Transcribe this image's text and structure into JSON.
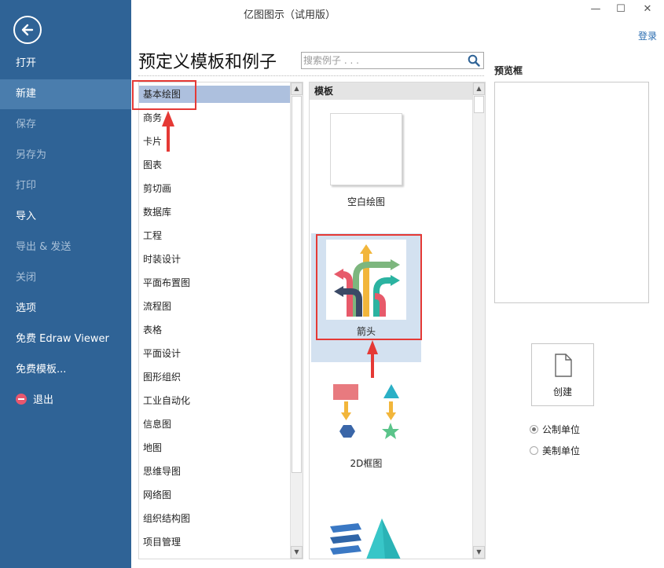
{
  "window": {
    "title": "亿图图示（试用版）",
    "minimize": "—",
    "maximize": "☐",
    "close": "✕",
    "login": "登录"
  },
  "sidebar": {
    "items": [
      {
        "label": "打开"
      },
      {
        "label": "新建"
      },
      {
        "label": "保存"
      },
      {
        "label": "另存为"
      },
      {
        "label": "打印"
      },
      {
        "label": "导入"
      },
      {
        "label": "导出 & 发送"
      },
      {
        "label": "关闭"
      },
      {
        "label": "选项"
      },
      {
        "label": "免费 Edraw Viewer"
      },
      {
        "label": "免费模板..."
      },
      {
        "label": "退出"
      }
    ]
  },
  "main": {
    "heading": "预定义模板和例子",
    "search_placeholder": "搜索例子 . . .",
    "categories": [
      "基本绘图",
      "商务",
      "卡片",
      "图表",
      "剪切画",
      "数据库",
      "工程",
      "时装设计",
      "平面布置图",
      "流程图",
      "表格",
      "平面设计",
      "图形组织",
      "工业自动化",
      "信息图",
      "地图",
      "思维导图",
      "网络图",
      "组织结构图",
      "项目管理"
    ],
    "templates_header": "模板",
    "templates": [
      {
        "label": "空白绘图"
      },
      {
        "label": "箭头"
      },
      {
        "label": "2D框图"
      }
    ]
  },
  "preview": {
    "label": "预览框"
  },
  "create": {
    "label": "创建"
  },
  "units": [
    {
      "label": "公制单位",
      "selected": true
    },
    {
      "label": "美制单位",
      "selected": false
    }
  ],
  "colors": {
    "sidebar": "#2f6396",
    "sidebar_active": "#4a7dad",
    "selection": "#adc0de",
    "highlight_red": "#e53935"
  }
}
